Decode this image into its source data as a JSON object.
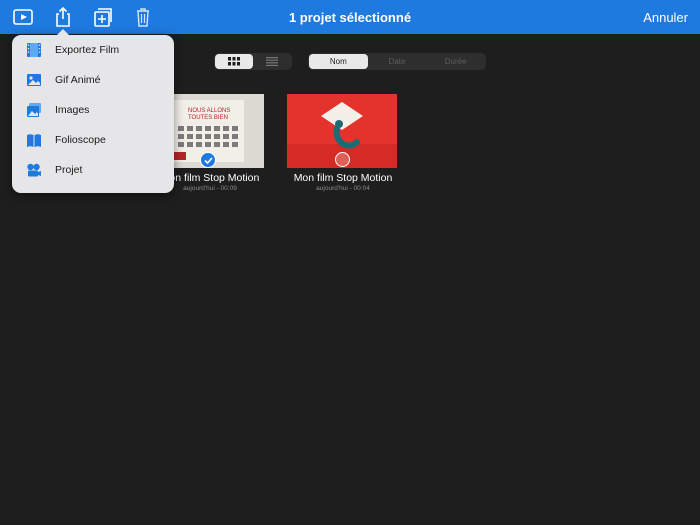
{
  "header": {
    "title": "1 projet sélectionné",
    "cancel_label": "Annuler",
    "accent": "#1f7ae0"
  },
  "toolbar": {
    "icons": [
      "play-icon",
      "share-icon",
      "duplicate-icon",
      "trash-icon"
    ]
  },
  "view_toggle": {
    "options": [
      "grid-view-icon",
      "list-view-icon"
    ],
    "selected": "grid-view-icon"
  },
  "sort": {
    "options": [
      "Nom",
      "Date",
      "Durée"
    ],
    "selected": "Nom"
  },
  "projects": [
    {
      "title": "Mon film Stop Motion",
      "subtitle": "aujourd'hui - 00:09",
      "selected": true,
      "thumbnail_text": "NOUS ALLONS TOUTES BIEN"
    },
    {
      "title": "Mon film Stop Motion",
      "subtitle": "aujourd'hui - 00:04",
      "selected": false
    }
  ],
  "export_menu": {
    "items": [
      {
        "label": "Exportez Film",
        "icon": "film-icon"
      },
      {
        "label": "Gif Animé",
        "icon": "image-icon"
      },
      {
        "label": "Images",
        "icon": "images-icon"
      },
      {
        "label": "Folioscope",
        "icon": "book-icon"
      },
      {
        "label": "Projet",
        "icon": "projector-icon"
      }
    ]
  }
}
